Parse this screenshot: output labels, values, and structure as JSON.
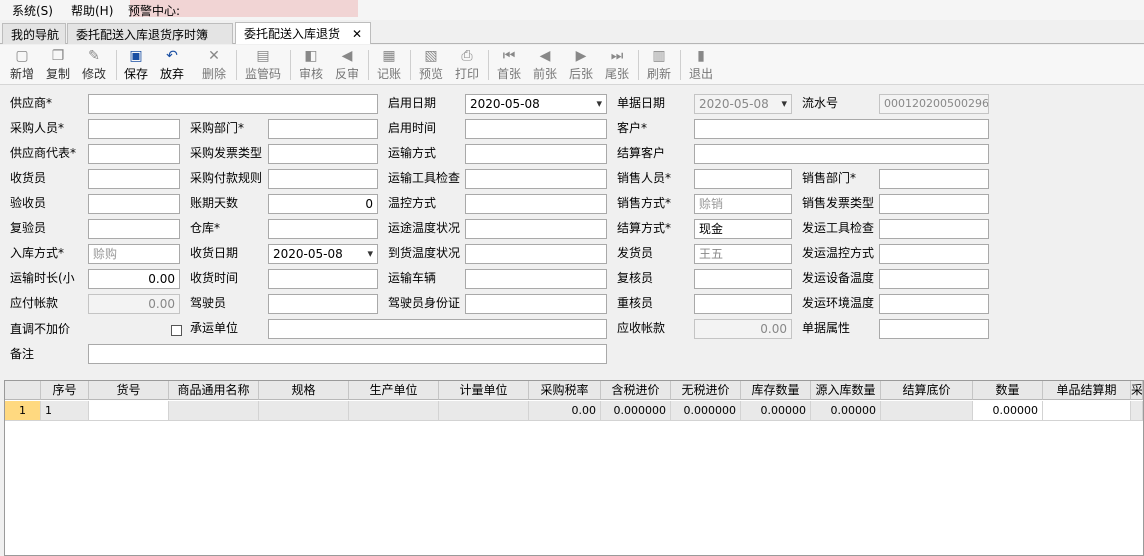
{
  "menu": {
    "items": [
      "系统(S)",
      "帮助(H)",
      "预警中心:"
    ]
  },
  "tabs": [
    {
      "label": "我的导航"
    },
    {
      "label": "委托配送入库退货序时簿"
    },
    {
      "label": "委托配送入库退货",
      "close": "✕"
    }
  ],
  "toolbar": {
    "buttons": [
      {
        "label": "新增",
        "icon": "new-doc-icon",
        "glyph": "▢"
      },
      {
        "label": "复制",
        "icon": "copy-icon",
        "glyph": "❐"
      },
      {
        "label": "修改",
        "icon": "edit-icon",
        "glyph": "✎"
      },
      {
        "label": "保存",
        "icon": "save-icon",
        "glyph": "▣"
      },
      {
        "label": "放弃",
        "icon": "undo-icon",
        "glyph": "↶"
      },
      {
        "label": "删除",
        "icon": "delete-icon",
        "glyph": "✕"
      },
      {
        "label": "监管码",
        "icon": "barcode-icon",
        "glyph": "▤"
      },
      {
        "label": "审核",
        "icon": "approve-icon",
        "glyph": "◧"
      },
      {
        "label": "反审",
        "icon": "unapprove-icon",
        "glyph": "◀"
      },
      {
        "label": "记账",
        "icon": "ledger-icon",
        "glyph": "▦"
      },
      {
        "label": "预览",
        "icon": "preview-icon",
        "glyph": "▧"
      },
      {
        "label": "打印",
        "icon": "print-icon",
        "glyph": "⎙"
      },
      {
        "label": "首张",
        "icon": "first-icon",
        "glyph": "⏮"
      },
      {
        "label": "前张",
        "icon": "prev-icon",
        "glyph": "◀"
      },
      {
        "label": "后张",
        "icon": "next-icon",
        "glyph": "▶"
      },
      {
        "label": "尾张",
        "icon": "last-icon",
        "glyph": "⏭"
      },
      {
        "label": "刷新",
        "icon": "refresh-icon",
        "glyph": "▥"
      },
      {
        "label": "退出",
        "icon": "exit-icon",
        "glyph": "▮"
      }
    ]
  },
  "form": {
    "supplier": {
      "label": "供应商*",
      "value": ""
    },
    "enable_date": {
      "label": "启用日期",
      "value": "2020-05-08"
    },
    "doc_date": {
      "label": "单据日期",
      "value": "2020-05-08"
    },
    "serial_no": {
      "label": "流水号",
      "value": "000120200500296"
    },
    "purchaser": {
      "label": "采购人员*",
      "value": ""
    },
    "purchase_dept": {
      "label": "采购部门*",
      "value": ""
    },
    "enable_time": {
      "label": "启用时间",
      "value": ""
    },
    "customer": {
      "label": "客户*",
      "value": ""
    },
    "supplier_rep": {
      "label": "供应商代表*",
      "value": ""
    },
    "invoice_type": {
      "label": "采购发票类型",
      "value": ""
    },
    "transport_mode": {
      "label": "运输方式",
      "value": ""
    },
    "settle_customer": {
      "label": "结算客户",
      "value": ""
    },
    "receiver": {
      "label": "收货员",
      "value": ""
    },
    "payment_rule": {
      "label": "采购付款规则",
      "value": ""
    },
    "vehicle_check": {
      "label": "运输工具检查",
      "value": ""
    },
    "sales_person": {
      "label": "销售人员*",
      "value": ""
    },
    "sales_dept": {
      "label": "销售部门*",
      "value": ""
    },
    "inspector": {
      "label": "验收员",
      "value": ""
    },
    "account_days": {
      "label": "账期天数",
      "value": "0"
    },
    "temp_control": {
      "label": "温控方式",
      "value": ""
    },
    "sales_mode": {
      "label": "销售方式*",
      "value": "赊销"
    },
    "sales_invoice_type": {
      "label": "销售发票类型",
      "value": ""
    },
    "rechecker": {
      "label": "复验员",
      "value": ""
    },
    "warehouse": {
      "label": "仓库*",
      "value": ""
    },
    "transit_temp": {
      "label": "运途温度状况",
      "value": ""
    },
    "settle_mode": {
      "label": "结算方式*",
      "value": "现金"
    },
    "ship_vehicle_check": {
      "label": "发运工具检查",
      "value": ""
    },
    "inbound_mode": {
      "label": "入库方式*",
      "value": "赊购"
    },
    "receive_date": {
      "label": "收货日期",
      "value": "2020-05-08"
    },
    "arrival_temp": {
      "label": "到货温度状况",
      "value": ""
    },
    "shipper": {
      "label": "发货员",
      "value": "王五"
    },
    "ship_temp_mode": {
      "label": "发运温控方式",
      "value": ""
    },
    "transport_hours": {
      "label": "运输时长(小",
      "value": "0.00"
    },
    "receive_time": {
      "label": "收货时间",
      "value": ""
    },
    "vehicle": {
      "label": "运输车辆",
      "value": ""
    },
    "reviewer": {
      "label": "复核员",
      "value": ""
    },
    "ship_equip_temp": {
      "label": "发运设备温度",
      "value": ""
    },
    "payable": {
      "label": "应付帐款",
      "value": "0.00"
    },
    "driver": {
      "label": "驾驶员",
      "value": ""
    },
    "driver_id": {
      "label": "驾驶员身份证",
      "value": ""
    },
    "rechecker2": {
      "label": "重核员",
      "value": ""
    },
    "ship_env_temp": {
      "label": "发运环境温度",
      "value": ""
    },
    "direct_no_markup": {
      "label": "直调不加价",
      "checked": false
    },
    "carrier": {
      "label": "承运单位",
      "value": ""
    },
    "receivable": {
      "label": "应收帐款",
      "value": "0.00"
    },
    "doc_attr": {
      "label": "单据属性",
      "value": ""
    },
    "remarks": {
      "label": "备注",
      "value": ""
    }
  },
  "grid": {
    "columns": [
      "序号",
      "货号",
      "商品通用名称",
      "规格",
      "生产单位",
      "计量单位",
      "采购税率",
      "含税进价",
      "无税进价",
      "库存数量",
      "源入库数量",
      "结算底价",
      "数量",
      "单品结算期",
      "采"
    ],
    "rows": [
      {
        "row_no": "1",
        "cells": [
          "1",
          "",
          "",
          "",
          "",
          "",
          "0.00",
          "0.000000",
          "0.000000",
          "0.00000",
          "0.00000",
          "",
          "0.00000",
          "",
          ""
        ]
      }
    ]
  }
}
